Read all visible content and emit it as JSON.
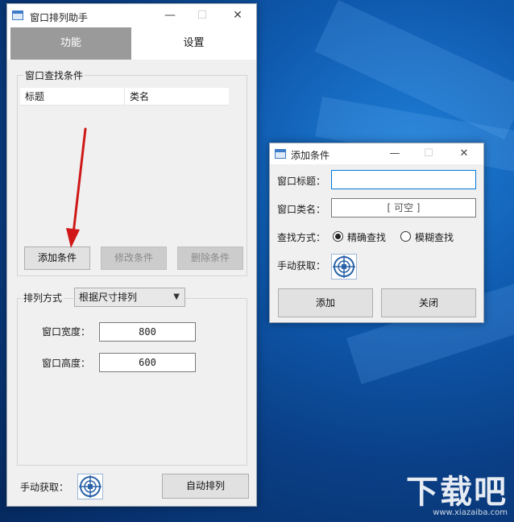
{
  "main_window": {
    "title": "窗口排列助手",
    "tabs": [
      {
        "label": "功能",
        "active": true
      },
      {
        "label": "设置",
        "active": false
      }
    ],
    "find_conditions": {
      "group_label": "窗口查找条件",
      "columns": [
        "标题",
        "类名"
      ],
      "rows": [],
      "add_button": "添加条件",
      "modify_button": "修改条件",
      "delete_button": "删除条件"
    },
    "arrange": {
      "label": "排列方式",
      "selected": "根据尺寸排列",
      "width_label": "窗口宽度：",
      "width_value": "800",
      "height_label": "窗口高度：",
      "height_value": "600"
    },
    "manual_label": "手动获取：",
    "auto_arrange_button": "自动排列"
  },
  "dialog": {
    "title": "添加条件",
    "title_label": "窗口标题：",
    "title_value": "",
    "class_label": "窗口类名：",
    "class_value": "[ 可空 ]",
    "method_label": "查找方式：",
    "method_options": [
      {
        "label": "精确查找",
        "checked": true
      },
      {
        "label": "模糊查找",
        "checked": false
      }
    ],
    "manual_label": "手动获取：",
    "add_button": "添加",
    "close_button": "关闭"
  },
  "watermark": {
    "logo": "下载吧",
    "url": "www.xiazaiba.com"
  },
  "colors": {
    "active_tab": "#9a9a9a",
    "annotation_arrow": "#d01818",
    "focus_border": "#0078d7",
    "desktop": "#0f5bb0"
  }
}
